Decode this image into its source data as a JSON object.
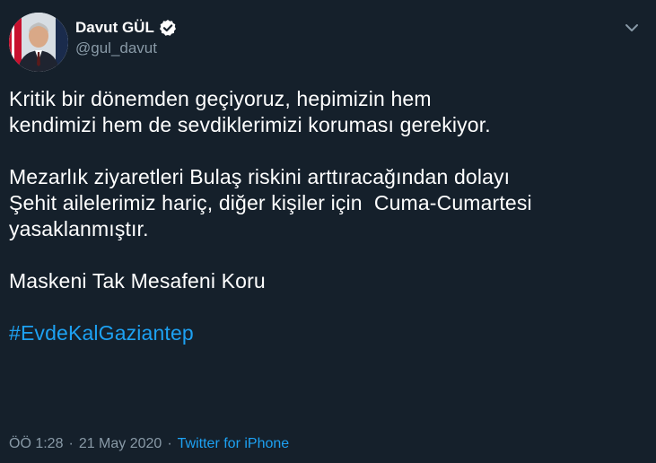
{
  "theme": {
    "background": "#15202b",
    "text": "#ffffff",
    "secondary": "#8899a6",
    "accent": "#1da1f2"
  },
  "author": {
    "display_name": "Davut GÜL",
    "handle": "@gul_davut",
    "verified_icon": "verified-badge-icon",
    "avatar_icon": "profile-photo"
  },
  "menu": {
    "icon": "chevron-down-icon"
  },
  "tweet": {
    "lines": [
      "Kritik bir dönemden geçiyoruz, hepimizin hem",
      "kendimizi hem de sevdiklerimizi koruması gerekiyor.",
      "",
      "Mezarlık ziyaretleri Bulaş riskini arttıracağından dolayı",
      "Şehit ailelerimiz hariç, diğer kişiler için  Cuma-Cumartesi",
      "yasaklanmıştır.",
      "",
      "Maskeni Tak Mesafeni Koru",
      ""
    ],
    "hashtag": "#EvdeKalGaziantep"
  },
  "footer": {
    "time": "ÖÖ 1:28",
    "separator": "·",
    "date": "21 May 2020",
    "source": "Twitter for iPhone"
  }
}
